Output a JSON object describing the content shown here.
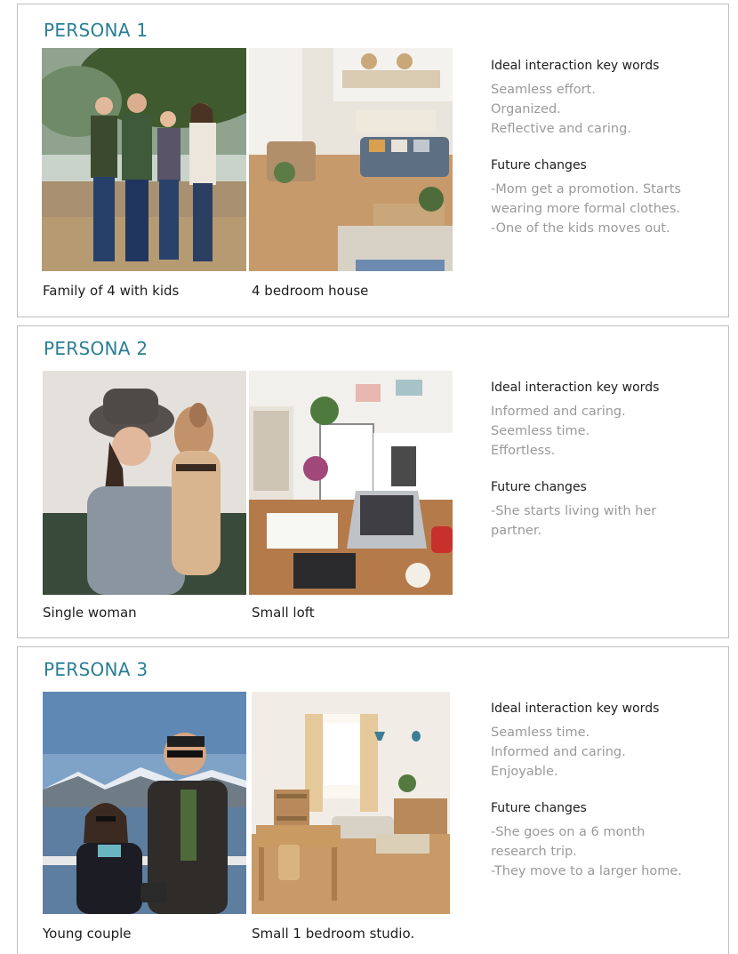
{
  "personas": [
    {
      "title": "PERSONA 1",
      "photo_left": {
        "caption": "Family of 4 with kids",
        "icon": "family-photo"
      },
      "photo_right": {
        "caption": "4 bedroom house",
        "icon": "living-room-photo"
      },
      "keywords_heading": "Ideal interaction key words",
      "keywords": [
        "Seamless effort.",
        "Organized.",
        "Reflective and caring."
      ],
      "changes_heading": "Future changes",
      "changes": [
        "-Mom get a promotion. Starts",
        "wearing more formal clothes.",
        "-One of the kids moves out."
      ]
    },
    {
      "title": "PERSONA 2",
      "photo_left": {
        "caption": "Single woman",
        "icon": "woman-with-dog-photo"
      },
      "photo_right": {
        "caption": "Small loft",
        "icon": "desk-loft-photo"
      },
      "keywords_heading": "Ideal interaction key words",
      "keywords": [
        "Informed and caring.",
        "Seemless time.",
        "Effortless."
      ],
      "changes_heading": "Future changes",
      "changes": [
        "-She starts living with her",
        "partner."
      ]
    },
    {
      "title": "PERSONA 3",
      "photo_left": {
        "caption": "Young couple",
        "icon": "couple-photo"
      },
      "photo_right": {
        "caption": "Small 1 bedroom studio.",
        "icon": "studio-apartment-photo"
      },
      "keywords_heading": "Ideal interaction key words",
      "keywords": [
        "Seamless time.",
        "Informed and caring.",
        "Enjoyable."
      ],
      "changes_heading": "Future changes",
      "changes": [
        "-She goes on a 6 month",
        "research trip.",
        "-They move to a larger home."
      ]
    }
  ],
  "colors": {
    "title": "#2a7e96",
    "heading": "#1d1d1d",
    "muted": "#9a9a9a",
    "border": "#bfbfbf"
  }
}
